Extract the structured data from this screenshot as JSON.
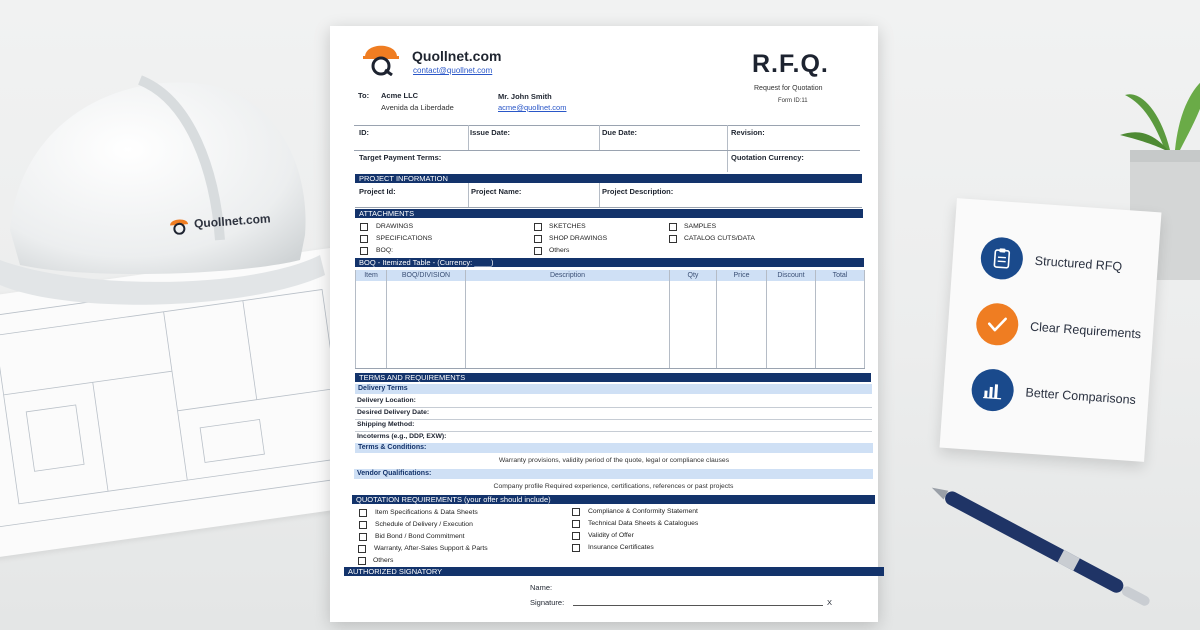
{
  "colors": {
    "navy": "#13336b",
    "light_blue": "#cfe0f5",
    "orange": "#ef7d22",
    "link_blue": "#2a57c8"
  },
  "helmet": {
    "logo_text": "Quollnet.com"
  },
  "sheet": {
    "brand_name": "Quollnet.com",
    "brand_email": "contact@quollnet.com",
    "title": "R.F.Q.",
    "subtitle": "Request for Quotation",
    "form_id": "Form ID:11",
    "to_label": "To:",
    "to_company": "Acme LLC",
    "to_address": "Avenida da Liberdade",
    "contact_name": "Mr. John Smith",
    "contact_email": "acme@quollnet.com",
    "header_fields": {
      "id": "ID:",
      "issue_date": "Issue Date:",
      "due_date": "Due Date:",
      "revision": "Revision:",
      "target_payment": "Target Payment Terms:",
      "quotation_currency": "Quotation Currency:"
    },
    "project": {
      "heading": "PROJECT INFORMATION",
      "project_id": "Project Id:",
      "project_name": "Project Name:",
      "project_description": "Project Description:"
    },
    "attachments": {
      "heading": "ATTACHMENTS",
      "items": [
        "DRAWINGS",
        "SPECIFICATIONS",
        "BOQ:",
        "SKETCHES",
        "SHOP DRAWINGS",
        "Others",
        "SAMPLES",
        "CATALOG CUTS/DATA"
      ]
    },
    "boq": {
      "heading": "BOQ - Itemized Table - (Currency: ____)",
      "columns": [
        "Item",
        "BOQ/DIVISION",
        "Description",
        "Qty",
        "Price",
        "Discount",
        "Total"
      ]
    },
    "terms": {
      "heading": "TERMS AND REQUIREMENTS",
      "delivery_terms": "Delivery Terms",
      "delivery_location": "Delivery Location:",
      "desired_date": "Desired Delivery Date:",
      "shipping_method": "Shipping Method:",
      "incoterms": "Incoterms (e.g., DDP, EXW):",
      "terms_conditions": "Terms & Conditions:",
      "terms_text": "Warranty provisions, validity period of the quote, legal or compliance clauses",
      "vendor_qualifications": "Vendor Qualifications:",
      "vendor_text": "Company profile Required experience, certifications, references or past projects"
    },
    "quotation": {
      "heading": "QUOTATION REQUIREMENTS (your offer should include)",
      "left": [
        "Item Specifications & Data Sheets",
        "Schedule of Delivery / Execution",
        "Bid Bond / Bond Commitment",
        "Warranty, After-Sales Support & Parts",
        "Others"
      ],
      "right": [
        "Compliance & Conformity Statement",
        "Technical Data Sheets & Catalogues",
        "Validity of Offer",
        "Insurance Certificates"
      ]
    },
    "signatory": {
      "heading": "AUTHORIZED SIGNATORY",
      "name": "Name:",
      "signature": "Signature:",
      "x": "X"
    }
  },
  "card": {
    "items": [
      {
        "label": "Structured RFQ",
        "icon": "clipboard-icon",
        "color": "#1a4a8c"
      },
      {
        "label": "Clear Requirements",
        "icon": "check-icon",
        "color": "#ef7d22"
      },
      {
        "label": "Better Comparisons",
        "icon": "bar-chart-icon",
        "color": "#1a4a8c"
      }
    ]
  }
}
